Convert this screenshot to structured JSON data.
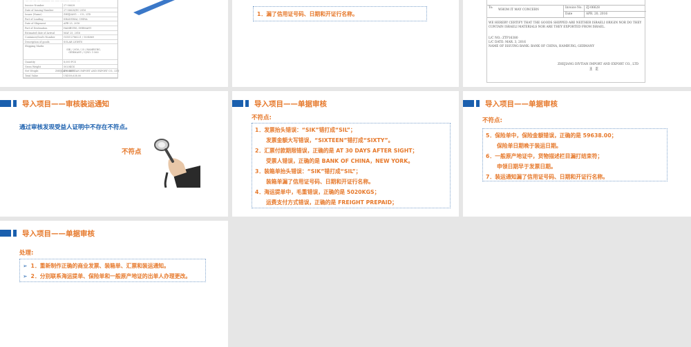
{
  "slide1": {
    "doc_rows": [
      {
        "k": "Invoice Number",
        "v": "27-06628"
      },
      {
        "k": "Date of Issuing Number",
        "v": "27-06628/EC-2016"
      },
      {
        "k": "Issuer (Name)",
        "v": "ZHEJIANG ... CO., LTD"
      },
      {
        "k": "Port of Loading",
        "v": "SHANGHAI, CHINA"
      },
      {
        "k": "Date of Shipment",
        "v": "APR 25, 2016"
      },
      {
        "k": "Port of Destination",
        "v": "HAMBURG, GERMANY"
      },
      {
        "k": "Estimated date of Arrival",
        "v": "MAY 25, 2016"
      },
      {
        "k": "Container/Seal's Number",
        "v": "GCXU2786221 / 1534869"
      },
      {
        "k": "Description of goods",
        "v": "SOLAR LIGHTS"
      },
      {
        "k": "Shipping Marks",
        "v": "SIK / 2016 / 25 / HAMBURG, GERMANY / C/NO. 1-560"
      },
      {
        "k": "Quantity",
        "v": "8,000 PCS"
      },
      {
        "k": "Gross Weight",
        "v": "5020KGS"
      },
      {
        "k": "Net Weight",
        "v": "4700KGS"
      },
      {
        "k": "Total Value",
        "v": "USD59,638.00"
      }
    ],
    "doc_foot": "ZHEJIANG DIVTIAN IMPORT AND EXPORT CO., LTD"
  },
  "slide2": {
    "items": [
      "1．漏了信用证号码、日期和开证行名称。"
    ]
  },
  "slide3": {
    "to_label": "To:",
    "to_value": "WHOM IT MAY CONCERN",
    "invoice_label": "Invoice No.",
    "invoice_value": "ZJ-06628",
    "date_label": "Date",
    "date_value": "APR. 20, 2016",
    "body": "WE HEREBY CERTIFY THAT THE GOODS SHIPPED ARE NEITHER ISRAELI ORIGIN NOR DO THEY CONTAIN ISRAELI MATERIALS NOR ARE THEY EXPORTED FROM ISRAEL.",
    "lc_no": "L/C NO.: ZTP16380",
    "lc_date": "L/C DATE: MAR. 3, 2016",
    "bank": "NAME OF ISSUING BANK: BANK OF CHINA, HAMBURG, GERMANY",
    "company": "ZHEJIANG DIVTIAN IMPORT AND EXPORT CO., LTD",
    "sign": "王　正"
  },
  "slide4": {
    "title": "导入项目——审核装运通知",
    "text": "通过审核发现受益人证明中不存在不符点。",
    "label": "不符点"
  },
  "slide5": {
    "title": "导入项目——单据审核",
    "subtitle": "不符点:",
    "lines": [
      "1．发票抬头错误：“SIK”错打成“SIL”；",
      "发票金额大写错误，“SIXTEEN”错打成“SIXTY”。",
      "2．汇票付款期限错误，正确的是 AT 30 DAYS AFTER SIGHT；",
      "受票人错误，正确的是 BANK OF CHINA，NEW YORK。",
      "3．装箱单抬头错误：“SIK”错打成“SIL”；",
      "装箱单漏了信用证号码、日期和开证行名称。",
      "4．海运提单中，毛重错误，正确的是 5020KGS；",
      "运费支付方式错误，正确的是 FREIGHT PREPAID；"
    ]
  },
  "slide6": {
    "title": "导入项目——单据审核",
    "subtitle": "不符点:",
    "lines": [
      "5．保险单中，保险金额错误，正确的是 59638.00；",
      "保险单日期晚于装运日期。",
      "6．一般原产地证中，货物描述栏目漏打结束符；",
      "申领日期早于发票日期。",
      "7．装运通知漏了信用证号码、日期和开证行名称。"
    ]
  },
  "slide7": {
    "title": "导入项目——单据审核",
    "subtitle": "处理:",
    "items": [
      "1．重新制作正确的商业发票、装箱单、汇票和装运通知。",
      "2．分别联系海运提单、保险单和一般原产地证的出单人办理更改。"
    ]
  },
  "colors": {
    "accent": "#e6782a",
    "brand": "#1a5fae",
    "divider": "#e6e6e6"
  }
}
